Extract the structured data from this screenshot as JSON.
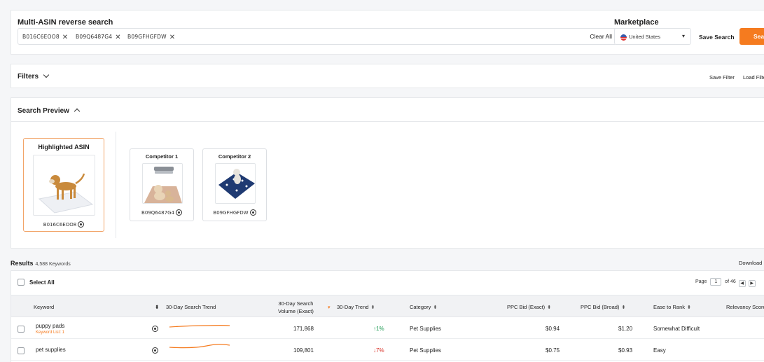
{
  "search": {
    "title": "Multi-ASIN reverse search",
    "asins": [
      "B016C6EOO8",
      "B09Q6487G4",
      "B09GFHGFDW"
    ],
    "remove_glyph": "✕",
    "clear_all": "Clear All",
    "marketplace_title": "Marketplace",
    "marketplace_value": "United States",
    "save_search": "Save Search",
    "search_button": "Search"
  },
  "filters": {
    "title": "Filters",
    "save_filter": "Save Filter",
    "load_filter": "Load Filter"
  },
  "preview": {
    "title": "Search Preview",
    "highlighted": {
      "title": "Highlighted ASIN",
      "asin": "B016C6EOO8"
    },
    "competitors": [
      {
        "title": "Competitor 1",
        "asin": "B09Q6487G4"
      },
      {
        "title": "Competitor 2",
        "asin": "B09GFHGFDW"
      }
    ]
  },
  "results": {
    "title": "Results",
    "count": "4,588 Keywords",
    "download": "Download",
    "select_all": "Select All",
    "pager": {
      "page_label": "Page",
      "page": "1",
      "of_label": "of 46"
    },
    "columns": {
      "keyword": "Keyword",
      "trend": "30-Day Search Trend",
      "volume_line1": "30-Day Search",
      "volume_line2": "Volume (Exact)",
      "trend_pct": "30-Day Trend",
      "category": "Category",
      "ppc_exact": "PPC Bid (Exact)",
      "ppc_broad": "PPC Bid (Broad)",
      "ease": "Ease to Rank",
      "relevancy": "Relevancy Score"
    },
    "rows": [
      {
        "keyword": "puppy pads",
        "list": "Keyword List: 1",
        "volume": "171,868",
        "trend_pct": "↑1%",
        "trend_dir": "up",
        "category": "Pet Supplies",
        "ppc_exact": "$0.94",
        "ppc_broad": "$1.20",
        "ease": "Somewhat Difficult"
      },
      {
        "keyword": "pet supplies",
        "list": "",
        "volume": "109,801",
        "trend_pct": "↓7%",
        "trend_dir": "down",
        "category": "Pet Supplies",
        "ppc_exact": "$0.75",
        "ppc_broad": "$0.93",
        "ease": "Easy"
      }
    ]
  },
  "colors": {
    "accent": "#f57b1f",
    "up": "#1d9a52",
    "down": "#d9342b"
  },
  "icons": [
    "remove-x-icon",
    "us-flag-icon",
    "chevron-down-icon",
    "chevron-up-icon",
    "amazon-product-icon",
    "sort-icon"
  ]
}
